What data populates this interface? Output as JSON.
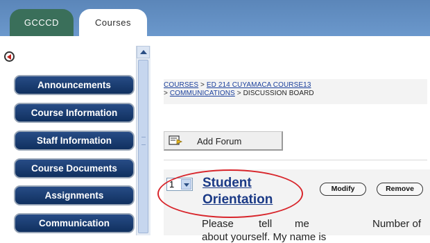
{
  "tabs": [
    {
      "label": "GCCCD"
    },
    {
      "label": "Courses"
    }
  ],
  "sidebar": {
    "items": [
      {
        "label": "Announcements"
      },
      {
        "label": "Course Information"
      },
      {
        "label": "Staff Information"
      },
      {
        "label": "Course Documents"
      },
      {
        "label": "Assignments"
      },
      {
        "label": "Communication"
      }
    ]
  },
  "breadcrumb": {
    "courses": "COURSES",
    "sep": ">",
    "course": "ED 214 CUYAMACA COURSE13",
    "communications": "COMMUNICATIONS",
    "current": "DISCUSSION BOARD"
  },
  "toolbar": {
    "add_forum_label": "Add Forum"
  },
  "forum": {
    "order": "1",
    "title_line1": "Student",
    "title_line2": "Orientation",
    "modify_label": "Modify",
    "remove_label": "Remove",
    "desc_words": [
      "Please",
      "tell",
      "me",
      "Number of"
    ],
    "desc_line2": "about            yourself.     My name is"
  },
  "colors": {
    "highlight": "#d8252b",
    "nav_button": "#1b3d73",
    "tab_bar": "#6592c6"
  }
}
